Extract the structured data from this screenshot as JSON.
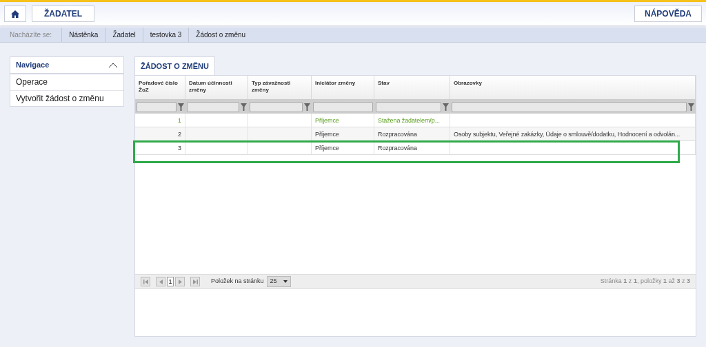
{
  "header": {
    "buttons": [
      {
        "kind": "home"
      },
      {
        "kind": "text",
        "label": "ŽADATEL"
      }
    ],
    "help": "NÁPOVĚDA"
  },
  "breadcrumb": {
    "label": "Nacházíte se:",
    "items": [
      "Nástěnka",
      "Žadatel",
      "testovka 3",
      "Žádost o změnu"
    ]
  },
  "sidebar": {
    "title": "Navigace",
    "expanded": true,
    "items": [
      "Operace",
      "Vytvořit žádost o změnu"
    ]
  },
  "panel": {
    "tab": "ŽÁDOST O ZMĚNU",
    "table": {
      "columns": [
        "Pořadové číslo ŽoZ",
        "Datum účinnosti změny",
        "Typ závažnosti změny",
        "Iniciátor změny",
        "Stav",
        "Obrazovky"
      ],
      "rows": [
        {
          "cells": [
            "1",
            "",
            "",
            "Příjemce",
            "Stažena žadatelem/p...",
            ""
          ],
          "kind": "withdrawn",
          "highlighted": false
        },
        {
          "cells": [
            "2",
            "",
            "",
            "Příjemce",
            "Rozpracována",
            "Osoby subjektu, Veřejné zakázky, Údaje o smlouvě/dodatku, Hodnocení a odvolán..."
          ],
          "kind": "normal",
          "highlighted": false
        },
        {
          "cells": [
            "3",
            "",
            "",
            "Příjemce",
            "Rozpracována",
            ""
          ],
          "kind": "normal",
          "highlighted": true
        }
      ]
    },
    "pager": {
      "page": "1",
      "page_size_label": "Položek na stránku",
      "page_size": "25",
      "summary": "Stránka **1** z **1**, položky **1** až **3** z **3**"
    }
  }
}
